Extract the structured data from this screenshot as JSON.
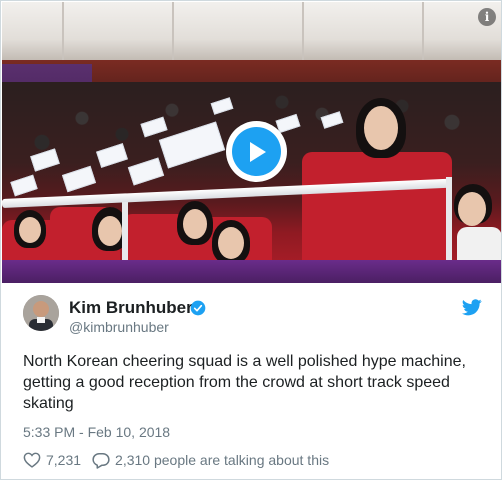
{
  "video": {
    "play_icon": "play-icon",
    "info_icon": "info-icon",
    "info_glyph": "i"
  },
  "tweet": {
    "author_name": "Kim Brunhuber",
    "author_handle": "@kimbrunhuber",
    "verified_icon": "verified-badge-icon",
    "brand_icon": "twitter-bird-icon",
    "text": "North Korean cheering squad is a well polished hype machine, getting a good reception from the crowd at short track speed skating",
    "timestamp": "5:33 PM - Feb 10, 2018",
    "likes": "7,231",
    "talking": "2,310 people are talking about this"
  },
  "colors": {
    "accent": "#1da1f2",
    "text": "#1c2022",
    "muted": "#697882"
  }
}
